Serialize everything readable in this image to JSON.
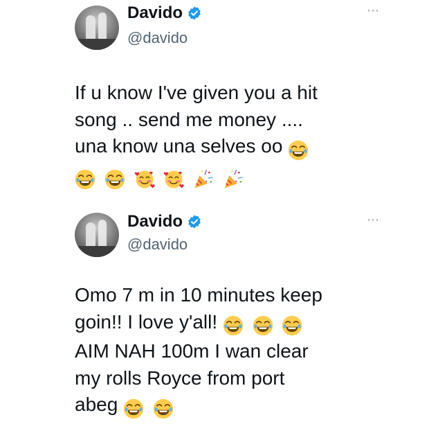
{
  "tweets": [
    {
      "author": "Davido",
      "handle": "@davido",
      "more_label": "⋯",
      "lines": [
        "If u know I've given you a hit",
        "song .. send me money ....",
        "una know una selves oo"
      ],
      "emoji_line1": [
        "joy-emoji"
      ],
      "emoji_line2": [
        "joy-emoji",
        "joy-emoji",
        "smiling-hearts-emoji",
        "smiling-hearts-emoji",
        "party-popper-emoji",
        "party-popper-emoji"
      ]
    },
    {
      "author": "Davido",
      "handle": "@davido",
      "more_label": "⋯",
      "lines": [
        "Omo 7 m in 10 minutes keep",
        "goin!! I love y'all!",
        "AIM NAH 100m I wan clear",
        "my rolls Royce from port",
        "abeg"
      ],
      "emoji_after_line2": [
        "joy-emoji",
        "joy-emoji",
        "joy-emoji"
      ],
      "emoji_after_line5": [
        "joy-emoji",
        "joy-emoji"
      ]
    }
  ],
  "colors": {
    "verified": "#1d9bf0",
    "text": "#0f1419",
    "secondary": "#536471",
    "emoji_face": "#ffcc4d"
  }
}
